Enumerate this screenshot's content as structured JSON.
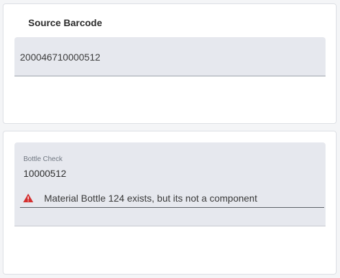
{
  "source_section": {
    "title": "Source Barcode",
    "value": "200046710000512"
  },
  "bottle_section": {
    "label": "Bottle Check",
    "value": "10000512",
    "error": {
      "icon": "warning-icon",
      "message": "Material Bottle 124 exists, but its not a component",
      "color": "#d32f2f"
    }
  },
  "colors": {
    "field_background": "#e6e8ee",
    "card_background": "#ffffff"
  }
}
